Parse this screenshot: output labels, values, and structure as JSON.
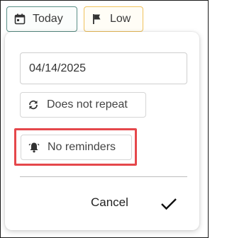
{
  "chips": {
    "date_label": "Today",
    "date_icon": "calendar-icon",
    "priority_label": "Low",
    "priority_icon": "flag-icon"
  },
  "popover": {
    "date_value": "04/14/2025",
    "repeat_label": "Does not repeat",
    "repeat_icon": "repeat-icon",
    "reminder_label": "No reminders",
    "reminder_icon": "bell-icon",
    "cancel_label": "Cancel",
    "confirm_icon": "checkmark-icon"
  },
  "colors": {
    "date_chip_border": "#5a8f86",
    "priority_chip_border": "#f0c25c",
    "highlight": "#e5474b"
  }
}
